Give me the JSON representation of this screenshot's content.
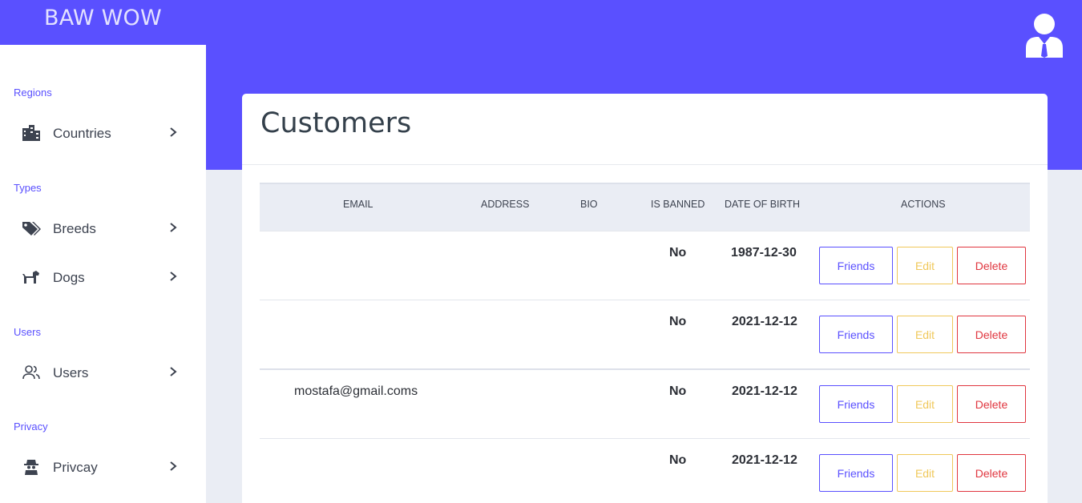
{
  "brand": "BAW WOW",
  "colors": {
    "accent": "#5a50ff",
    "friends": "#5a50ff",
    "edit": "#f0c85a",
    "delete": "#e0363f"
  },
  "sidebar": {
    "sections": [
      {
        "label": "Regions",
        "items": [
          {
            "label": "Countries",
            "icon": "city-icon"
          }
        ]
      },
      {
        "label": "Types",
        "items": [
          {
            "label": "Breeds",
            "icon": "tags-icon"
          },
          {
            "label": "Dogs",
            "icon": "dog-icon"
          }
        ]
      },
      {
        "label": "Users",
        "items": [
          {
            "label": "Users",
            "icon": "users-icon"
          }
        ]
      },
      {
        "label": "Privacy",
        "items": [
          {
            "label": "Privcay",
            "icon": "spy-icon"
          }
        ]
      }
    ]
  },
  "page": {
    "title": "Customers"
  },
  "table": {
    "headers": {
      "email": "EMAIL",
      "address": "ADDRESS",
      "bio": "BIO",
      "is_banned": "IS BANNED",
      "dob": "DATE OF BIRTH",
      "actions": "ACTIONS"
    },
    "rows": [
      {
        "email": "",
        "address": "",
        "bio": "",
        "is_banned": "No",
        "dob": "1987-12-30"
      },
      {
        "email": "",
        "address": "",
        "bio": "",
        "is_banned": "No",
        "dob": "2021-12-12"
      },
      {
        "email": "mostafa@gmail.coms",
        "address": "",
        "bio": "",
        "is_banned": "No",
        "dob": "2021-12-12"
      },
      {
        "email": "",
        "address": "",
        "bio": "",
        "is_banned": "No",
        "dob": "2021-12-12"
      }
    ],
    "actions": {
      "friends": "Friends",
      "edit": "Edit",
      "delete": "Delete"
    }
  }
}
